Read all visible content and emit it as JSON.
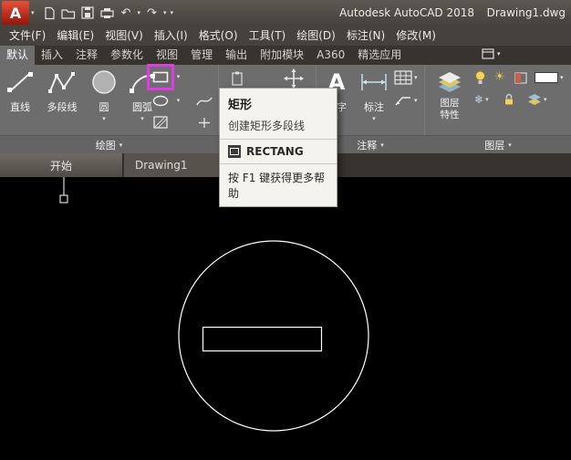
{
  "colors": {
    "highlight_magenta": "#df3bdf",
    "ribbon_gray": "#6d6d6d",
    "canvas_black": "#000000"
  },
  "icons": {
    "chevron_down": "▾",
    "undo": "↶",
    "redo": "↷",
    "text_tool": "A",
    "sun": "☀",
    "snowflake": "❄"
  },
  "titlebar": {
    "logo_letter": "A",
    "app_title": "Autodesk AutoCAD 2018",
    "doc_title": "Drawing1.dwg"
  },
  "menubar": {
    "items": [
      "文件(F)",
      "编辑(E)",
      "视图(V)",
      "插入(I)",
      "格式(O)",
      "工具(T)",
      "绘图(D)",
      "标注(N)",
      "修改(M)"
    ]
  },
  "ribbon_tabs": {
    "active": "默认",
    "items": [
      "默认",
      "插入",
      "注释",
      "参数化",
      "视图",
      "管理",
      "输出",
      "附加模块",
      "A360",
      "精选应用"
    ]
  },
  "draw_panel": {
    "label": "绘图",
    "line": "直线",
    "polyline": "多段线",
    "circle": "圆",
    "arc": "圆弧"
  },
  "annotate_panel": {
    "label": "注释",
    "text": "文字",
    "dimension": "标注"
  },
  "layer_panel": {
    "label": "图层",
    "properties_line1": "图层",
    "properties_line2": "特性"
  },
  "tooltip": {
    "title": "矩形",
    "description": "创建矩形多段线",
    "command": "RECTANG",
    "help": "按 F1 键获得更多帮助"
  },
  "file_tabs": {
    "start": "开始",
    "drawing": "Drawing1"
  }
}
